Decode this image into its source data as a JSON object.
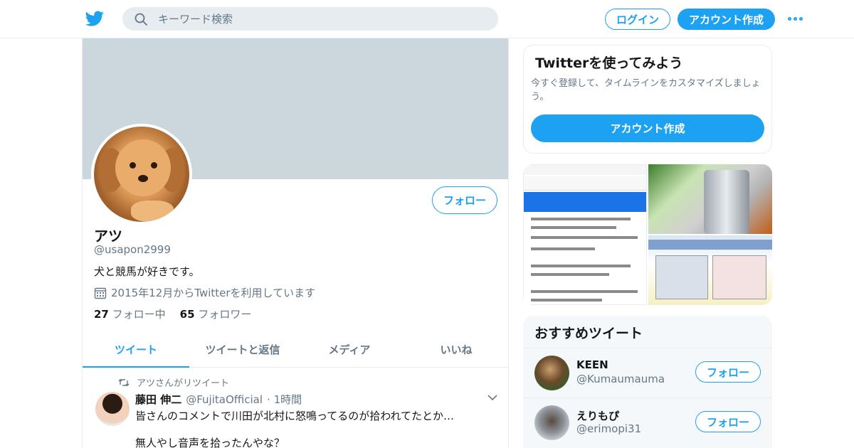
{
  "header": {
    "search_placeholder": "キーワード検索",
    "login_label": "ログイン",
    "signup_label": "アカウント作成",
    "accent_color": "#1da1f2"
  },
  "profile": {
    "name": "アツ",
    "handle": "@usapon2999",
    "bio": "犬と競馬が好きです。",
    "joined": "2015年12月からTwitterを利用しています",
    "following_count": "27",
    "following_label": "フォロー中",
    "followers_count": "65",
    "followers_label": "フォロワー",
    "follow_label": "フォロー"
  },
  "tabs": [
    {
      "label": "ツイート"
    },
    {
      "label": "ツイートと返信"
    },
    {
      "label": "メディア"
    },
    {
      "label": "いいね"
    }
  ],
  "tweet": {
    "retweet_label": "アツさんがリツイート",
    "author_name": "藤田 伸二",
    "author_handle": "@FujitaOfficial",
    "time": "· 1時間",
    "text_line1": "皆さんのコメントで川田が北村に怒鳴ってるのが拾われてたとか…",
    "text_line2": "無人やし音声を拾ったんやな？"
  },
  "promo": {
    "title": "Twitterを使ってみよう",
    "text": "今すぐ登録して、タイムラインをカスタマイズしましょう。",
    "button": "アカウント作成"
  },
  "recommendations": {
    "title": "おすすめツイート",
    "items": [
      {
        "name": "KEEN",
        "handle": "@Kumaumauma",
        "follow": "フォロー"
      },
      {
        "name": "えりもぴ",
        "handle": "@erimopi31",
        "follow": "フォロー"
      }
    ]
  }
}
